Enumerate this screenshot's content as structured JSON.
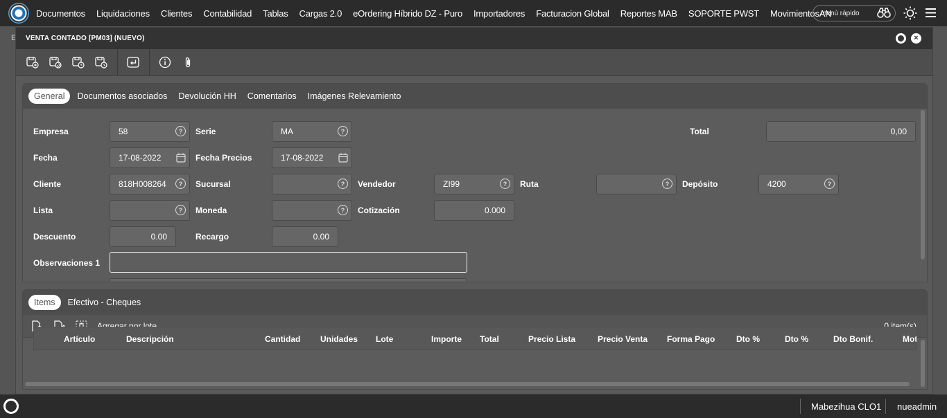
{
  "nav": {
    "items": [
      "Documentos",
      "Liquidaciones",
      "Clientes",
      "Contabilidad",
      "Tablas",
      "Cargas 2.0",
      "eOrdering Híbrido DZ - Puro",
      "Importadores",
      "Facturacion Global",
      "Reportes MAB",
      "SOPORTE PWST",
      "MovimientosAN"
    ],
    "quick_menu": "menú rápido"
  },
  "backdrop_hint": "E",
  "modal": {
    "title": "VENTA CONTADO [PM03] (NUEVO)",
    "close_glyph": "×"
  },
  "top_tabs": [
    {
      "label": "General",
      "active": true
    },
    {
      "label": "Documentos asociados",
      "active": false
    },
    {
      "label": "Devolución HH",
      "active": false
    },
    {
      "label": "Comentarios",
      "active": false
    },
    {
      "label": "Imágenes Relevamiento",
      "active": false
    }
  ],
  "form": {
    "empresa": {
      "label": "Empresa",
      "value": "58"
    },
    "serie": {
      "label": "Serie",
      "value": "MA"
    },
    "total": {
      "label": "Total",
      "value": "0,00"
    },
    "fecha": {
      "label": "Fecha",
      "value": "17-08-2022"
    },
    "fecha_precios": {
      "label": "Fecha Precios",
      "value": "17-08-2022"
    },
    "cliente": {
      "label": "Cliente",
      "value": "818H008264"
    },
    "sucursal": {
      "label": "Sucursal",
      "value": ""
    },
    "vendedor": {
      "label": "Vendedor",
      "value": "ZI99"
    },
    "ruta": {
      "label": "Ruta",
      "value": ""
    },
    "deposito": {
      "label": "Depósito",
      "value": "4200"
    },
    "lista": {
      "label": "Lista",
      "value": ""
    },
    "moneda": {
      "label": "Moneda",
      "value": ""
    },
    "cotizacion": {
      "label": "Cotización",
      "value": "0.000"
    },
    "descuento": {
      "label": "Descuento",
      "value": "0.00"
    },
    "recargo": {
      "label": "Recargo",
      "value": "0.00"
    },
    "observaciones1": {
      "label": "Observaciones 1",
      "value": ""
    },
    "help_glyph": "?"
  },
  "bottom_tabs": [
    {
      "label": "Items",
      "active": true
    },
    {
      "label": "Efectivo - Cheques",
      "active": false
    }
  ],
  "items": {
    "add_by_lot": "Agregar por lote",
    "count": "0 item(s)",
    "columns": [
      "Artículo",
      "Descripción",
      "Cantidad",
      "Unidades",
      "Lote",
      "Importe",
      "Total",
      "Precio Lista",
      "Precio Venta",
      "Forma Pago",
      "Dto %",
      "Dto %",
      "Dto Bonif.",
      "Mot"
    ]
  },
  "status": {
    "company": "Mabezihua CLO1",
    "user": "nueadmin"
  },
  "icons": [
    "logo-icon",
    "binoculars-icon",
    "brightness-icon",
    "hamburger-menu-icon",
    "save-add-icon",
    "save-refresh-icon",
    "save-clock-icon",
    "save-history-icon",
    "return-icon",
    "info-icon",
    "paperclip-icon",
    "help-icon",
    "calendar-icon",
    "add-doc-icon",
    "edit-icon",
    "delete-icon"
  ],
  "colors": {
    "topbar": "#2b2b2b",
    "modal_bg": "#5a5a5a",
    "field_bg": "#666666"
  }
}
